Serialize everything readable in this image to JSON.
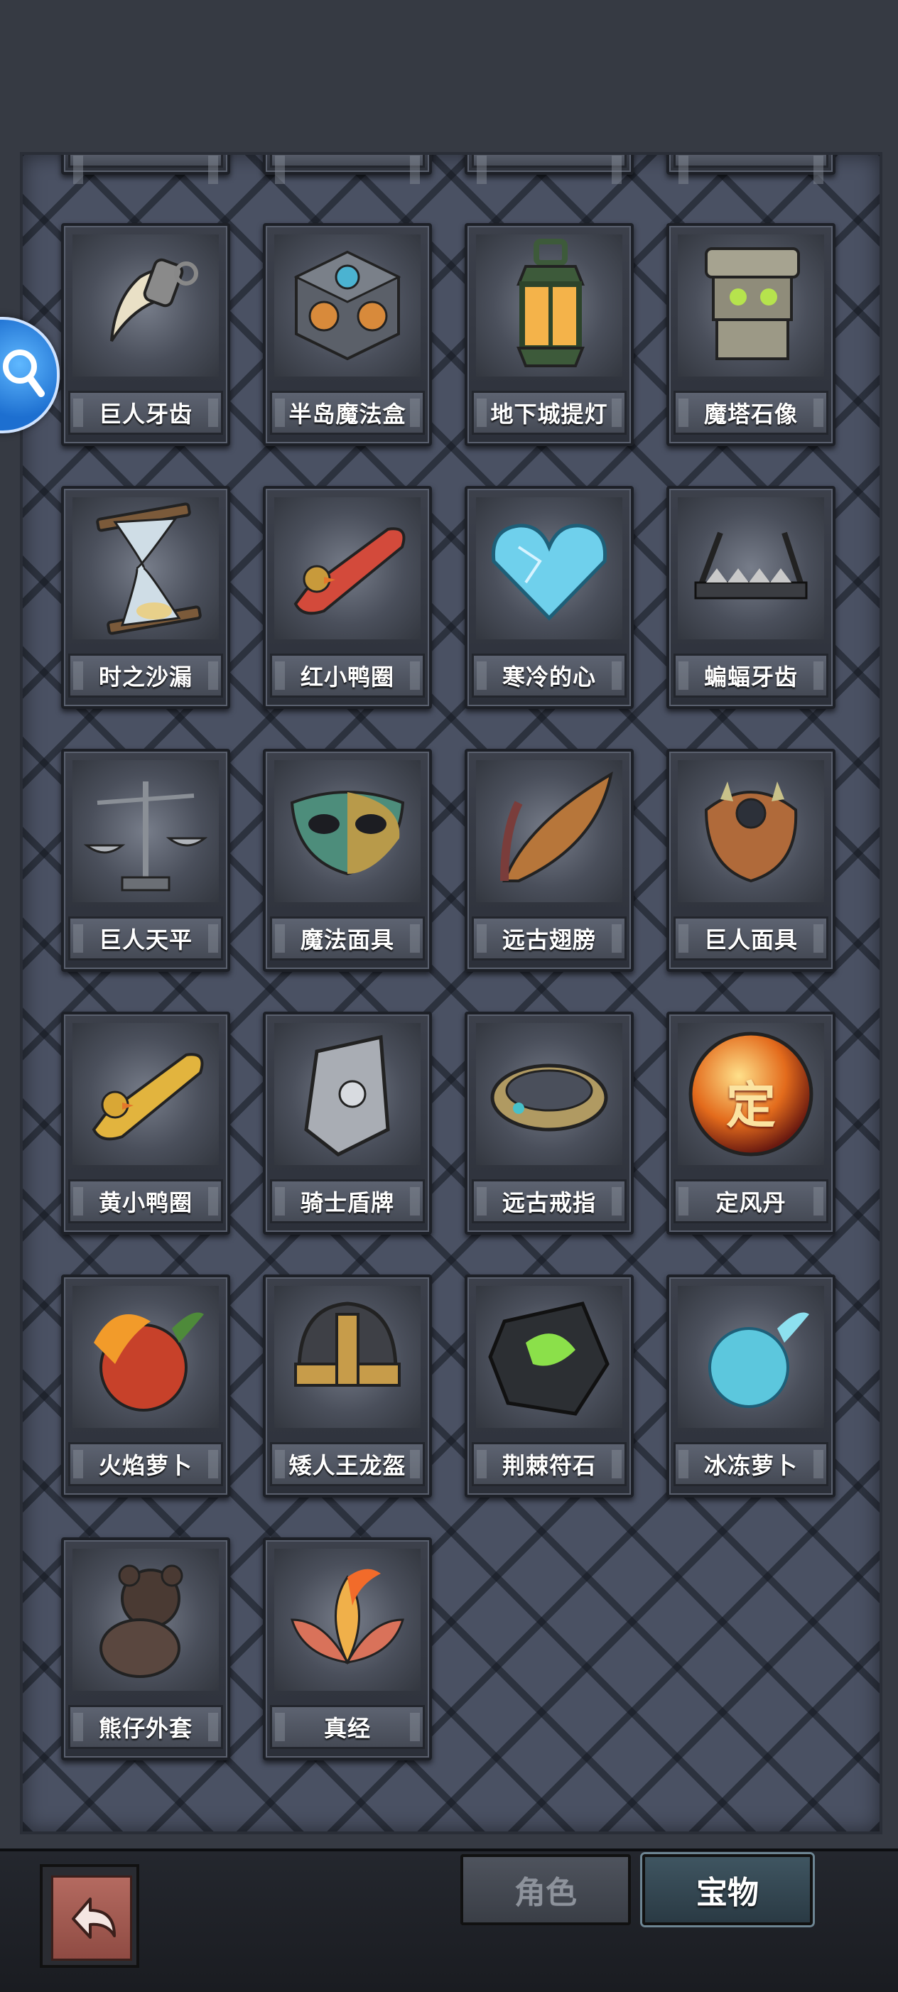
{
  "items": [
    {
      "name": "巨人牙齿",
      "icon": "claw-icon"
    },
    {
      "name": "半岛魔法盒",
      "icon": "magic-cube-icon"
    },
    {
      "name": "地下城提灯",
      "icon": "lantern-icon"
    },
    {
      "name": "魔塔石像",
      "icon": "stone-statue-icon"
    },
    {
      "name": "时之沙漏",
      "icon": "hourglass-icon"
    },
    {
      "name": "红小鸭圈",
      "icon": "red-duck-ring-icon"
    },
    {
      "name": "寒冷的心",
      "icon": "ice-heart-icon"
    },
    {
      "name": "蝙蝠牙齿",
      "icon": "bat-fangs-icon"
    },
    {
      "name": "巨人天平",
      "icon": "scales-icon"
    },
    {
      "name": "魔法面具",
      "icon": "magic-mask-icon"
    },
    {
      "name": "远古翅膀",
      "icon": "ancient-wing-icon"
    },
    {
      "name": "巨人面具",
      "icon": "giant-mask-icon"
    },
    {
      "name": "黄小鸭圈",
      "icon": "yellow-duck-ring-icon"
    },
    {
      "name": "骑士盾牌",
      "icon": "knight-shield-icon"
    },
    {
      "name": "远古戒指",
      "icon": "ancient-ring-icon"
    },
    {
      "name": "定风丹",
      "icon": "wind-pill-icon"
    },
    {
      "name": "火焰萝卜",
      "icon": "fire-radish-icon"
    },
    {
      "name": "矮人王龙盔",
      "icon": "dwarf-helmet-icon"
    },
    {
      "name": "荆棘符石",
      "icon": "thorn-rune-icon"
    },
    {
      "name": "冰冻萝卜",
      "icon": "frozen-radish-icon"
    },
    {
      "name": "熊仔外套",
      "icon": "teddy-bear-icon"
    },
    {
      "name": "真经",
      "icon": "lotus-scripture-icon"
    }
  ],
  "wind_pill_glyph": "定",
  "tabs": {
    "character": "角色",
    "treasure": "宝物"
  },
  "selected_tab": "宝物",
  "colors": {
    "panel": "#4a5163",
    "background": "#363a43",
    "active_tab": "#2a3a44"
  }
}
